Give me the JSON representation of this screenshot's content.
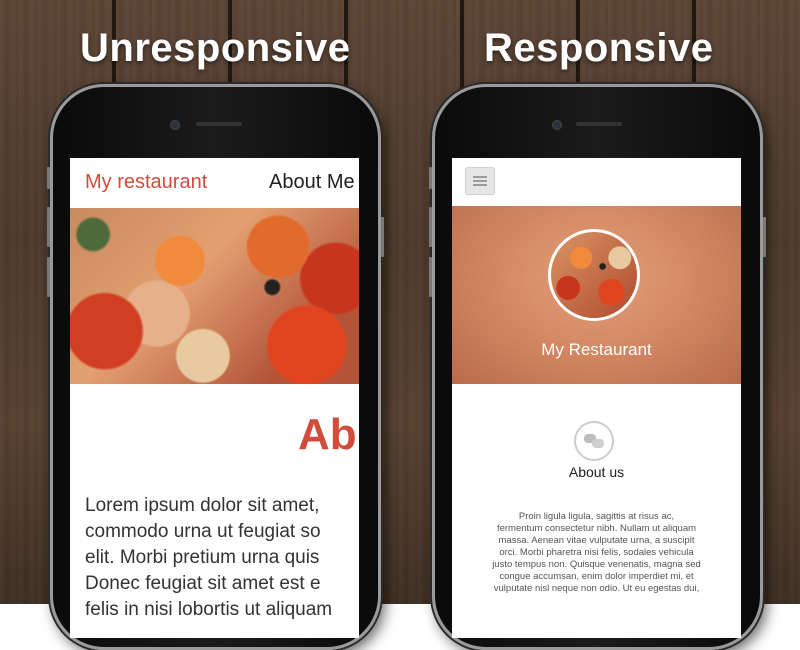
{
  "headings": {
    "left": "Unresponsive",
    "right": "Responsive"
  },
  "unresponsive": {
    "brand": "My restaurant",
    "nav_item": "About Me",
    "about_title": "Ab",
    "lorem": "Lorem ipsum dolor sit amet,\ncommodo urna ut feugiat so\nelit. Morbi pretium urna quis\nDonec feugiat sit amet est e\nfelis in nisi lobortis ut aliquam"
  },
  "responsive": {
    "menu_icon": "hamburger-menu-icon",
    "restaurant_name": "My Restaurant",
    "section_icon": "speech-bubbles-icon",
    "about_label": "About us",
    "body": "Proin ligula ligula, sagittis at risus ac,\nfermentum consectetur nibh. Nullam ut aliquam\nmassa. Aenean vitae vulputate urna, a suscipit\norci. Morbi pharetra nisi felis, sodales vehicula\njusto tempus non. Quisque venenatis, magna sed\ncongue accumsan, enim dolor imperdiet mi, et\nvulputate nisl neque non odio. Ut eu egestas dui,"
  },
  "colors": {
    "accent": "#d24c3c",
    "wood": "#4d3a2c"
  }
}
